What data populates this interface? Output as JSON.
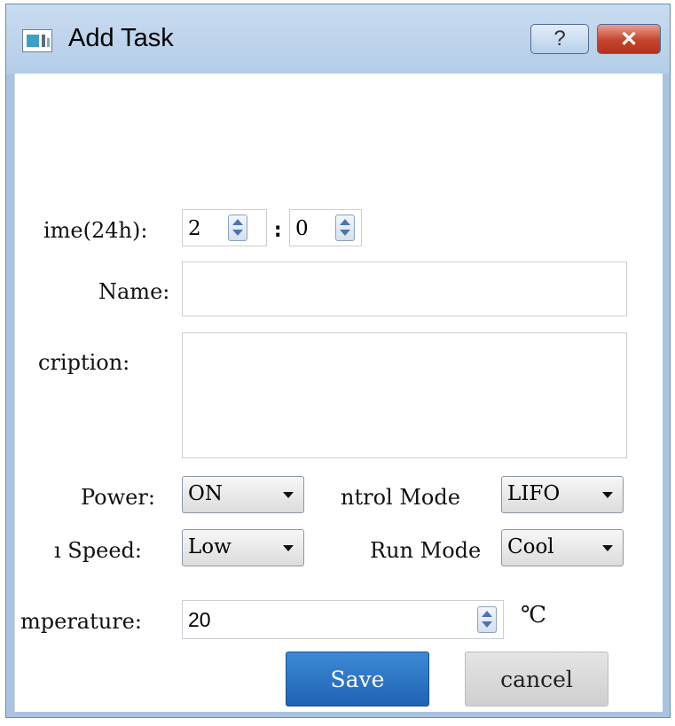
{
  "window": {
    "title": "Add Task",
    "help_label": "?",
    "close_label": "✕"
  },
  "form": {
    "time_label": "ime(24h):",
    "hour_value": "2",
    "time_separator": ":",
    "minute_value": "0",
    "name_label": "Name:",
    "name_value": "",
    "description_label": "cription:",
    "description_value": "",
    "power_label": "Power:",
    "power_value": "ON",
    "control_mode_label": "ntrol Mode",
    "control_mode_value": "LIFO",
    "fan_speed_label": "ı Speed:",
    "fan_speed_value": "Low",
    "run_mode_label": "Run Mode",
    "run_mode_value": "Cool",
    "temperature_label": "mperature:",
    "temperature_value": "20",
    "temperature_unit": "℃"
  },
  "buttons": {
    "save_label": "Save",
    "cancel_label": "cancel"
  },
  "colors": {
    "title_bar": "#b9d1ea",
    "close_button": "#c4442d",
    "save_button": "#2a72c4"
  }
}
